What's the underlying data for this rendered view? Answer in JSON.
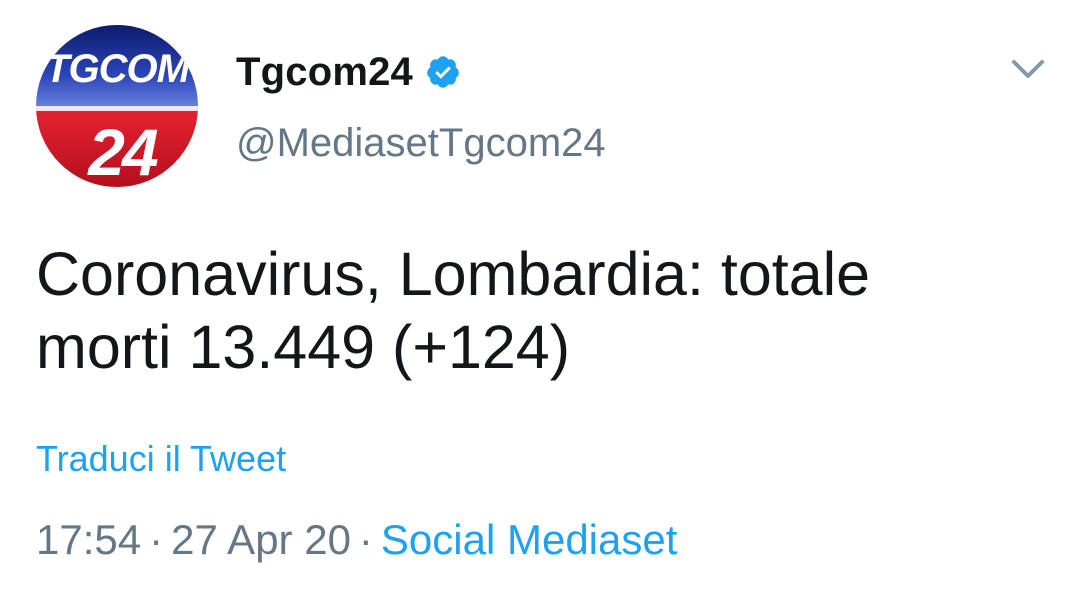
{
  "account": {
    "display_name": "Tgcom24",
    "handle": "@MediasetTgcom24",
    "verified": true,
    "avatar_text_top": "TGCOM",
    "avatar_text_bottom": "24",
    "avatar_icon": "tgcom24-logo"
  },
  "tweet": {
    "text_line1": "Coronavirus, Lombardia: totale",
    "text_line2": "morti 13.449 (+124)",
    "translate_label": "Traduci il Tweet",
    "time": "17:54",
    "date": "27 Apr 20",
    "separator": "·",
    "source": "Social Mediaset"
  },
  "icons": {
    "verified": "verified-badge-icon",
    "menu": "chevron-down-icon"
  },
  "colors": {
    "link": "#1da1f2",
    "secondary_text": "#657786",
    "primary_text": "#14171a",
    "verified": "#1da1f2",
    "logo_blue": "#1d2f8a",
    "logo_red": "#d7192a"
  }
}
